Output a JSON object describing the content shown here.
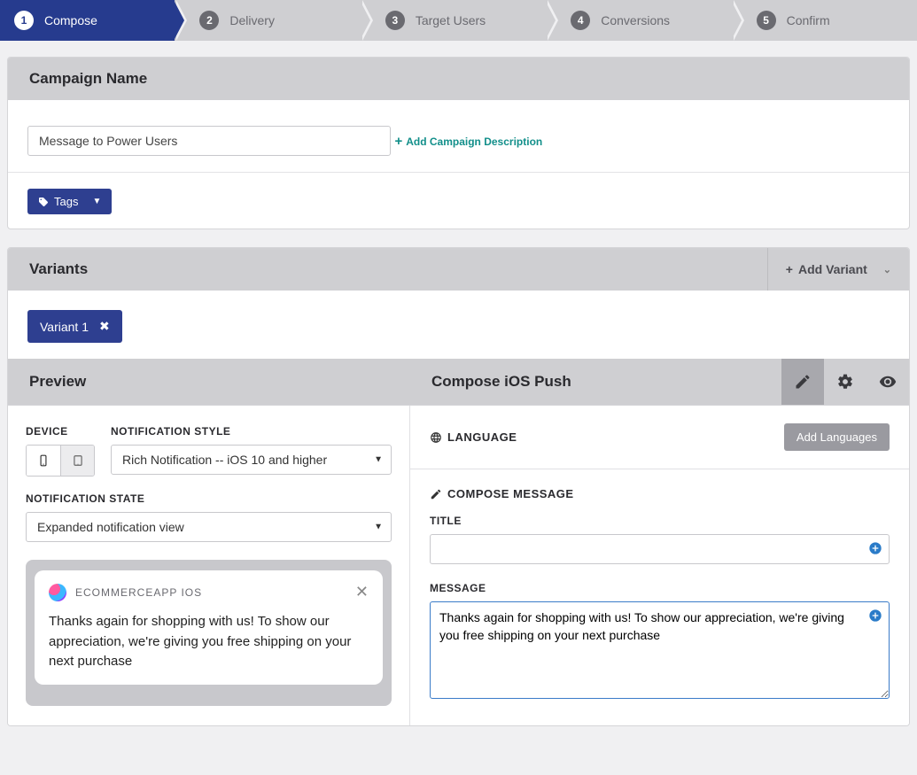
{
  "stepper": [
    {
      "num": "1",
      "label": "Compose",
      "active": true
    },
    {
      "num": "2",
      "label": "Delivery"
    },
    {
      "num": "3",
      "label": "Target Users"
    },
    {
      "num": "4",
      "label": "Conversions"
    },
    {
      "num": "5",
      "label": "Confirm"
    }
  ],
  "campaign": {
    "header": "Campaign Name",
    "name_value": "Message to Power Users",
    "add_desc_label": "Add Campaign Description",
    "tags_label": "Tags"
  },
  "variants": {
    "header": "Variants",
    "add_label": "Add Variant",
    "chip": "Variant 1"
  },
  "preview": {
    "header": "Preview",
    "device_label": "DEVICE",
    "notif_style_label": "NOTIFICATION STYLE",
    "notif_style_value": "Rich Notification -- iOS 10 and higher",
    "notif_state_label": "NOTIFICATION STATE",
    "notif_state_value": "Expanded notification view",
    "app_name": "ECOMMERCEAPP IOS",
    "message_body": "Thanks again for shopping with us! To show our appreciation, we're giving you free shipping on your next purchase"
  },
  "compose": {
    "header": "Compose iOS Push",
    "language_label": "LANGUAGE",
    "add_languages_label": "Add Languages",
    "compose_message_label": "COMPOSE MESSAGE",
    "title_label": "TITLE",
    "title_value": "",
    "message_label": "MESSAGE",
    "message_value": "Thanks again for shopping with us! To show our appreciation, we're giving you free shipping on your next purchase"
  }
}
